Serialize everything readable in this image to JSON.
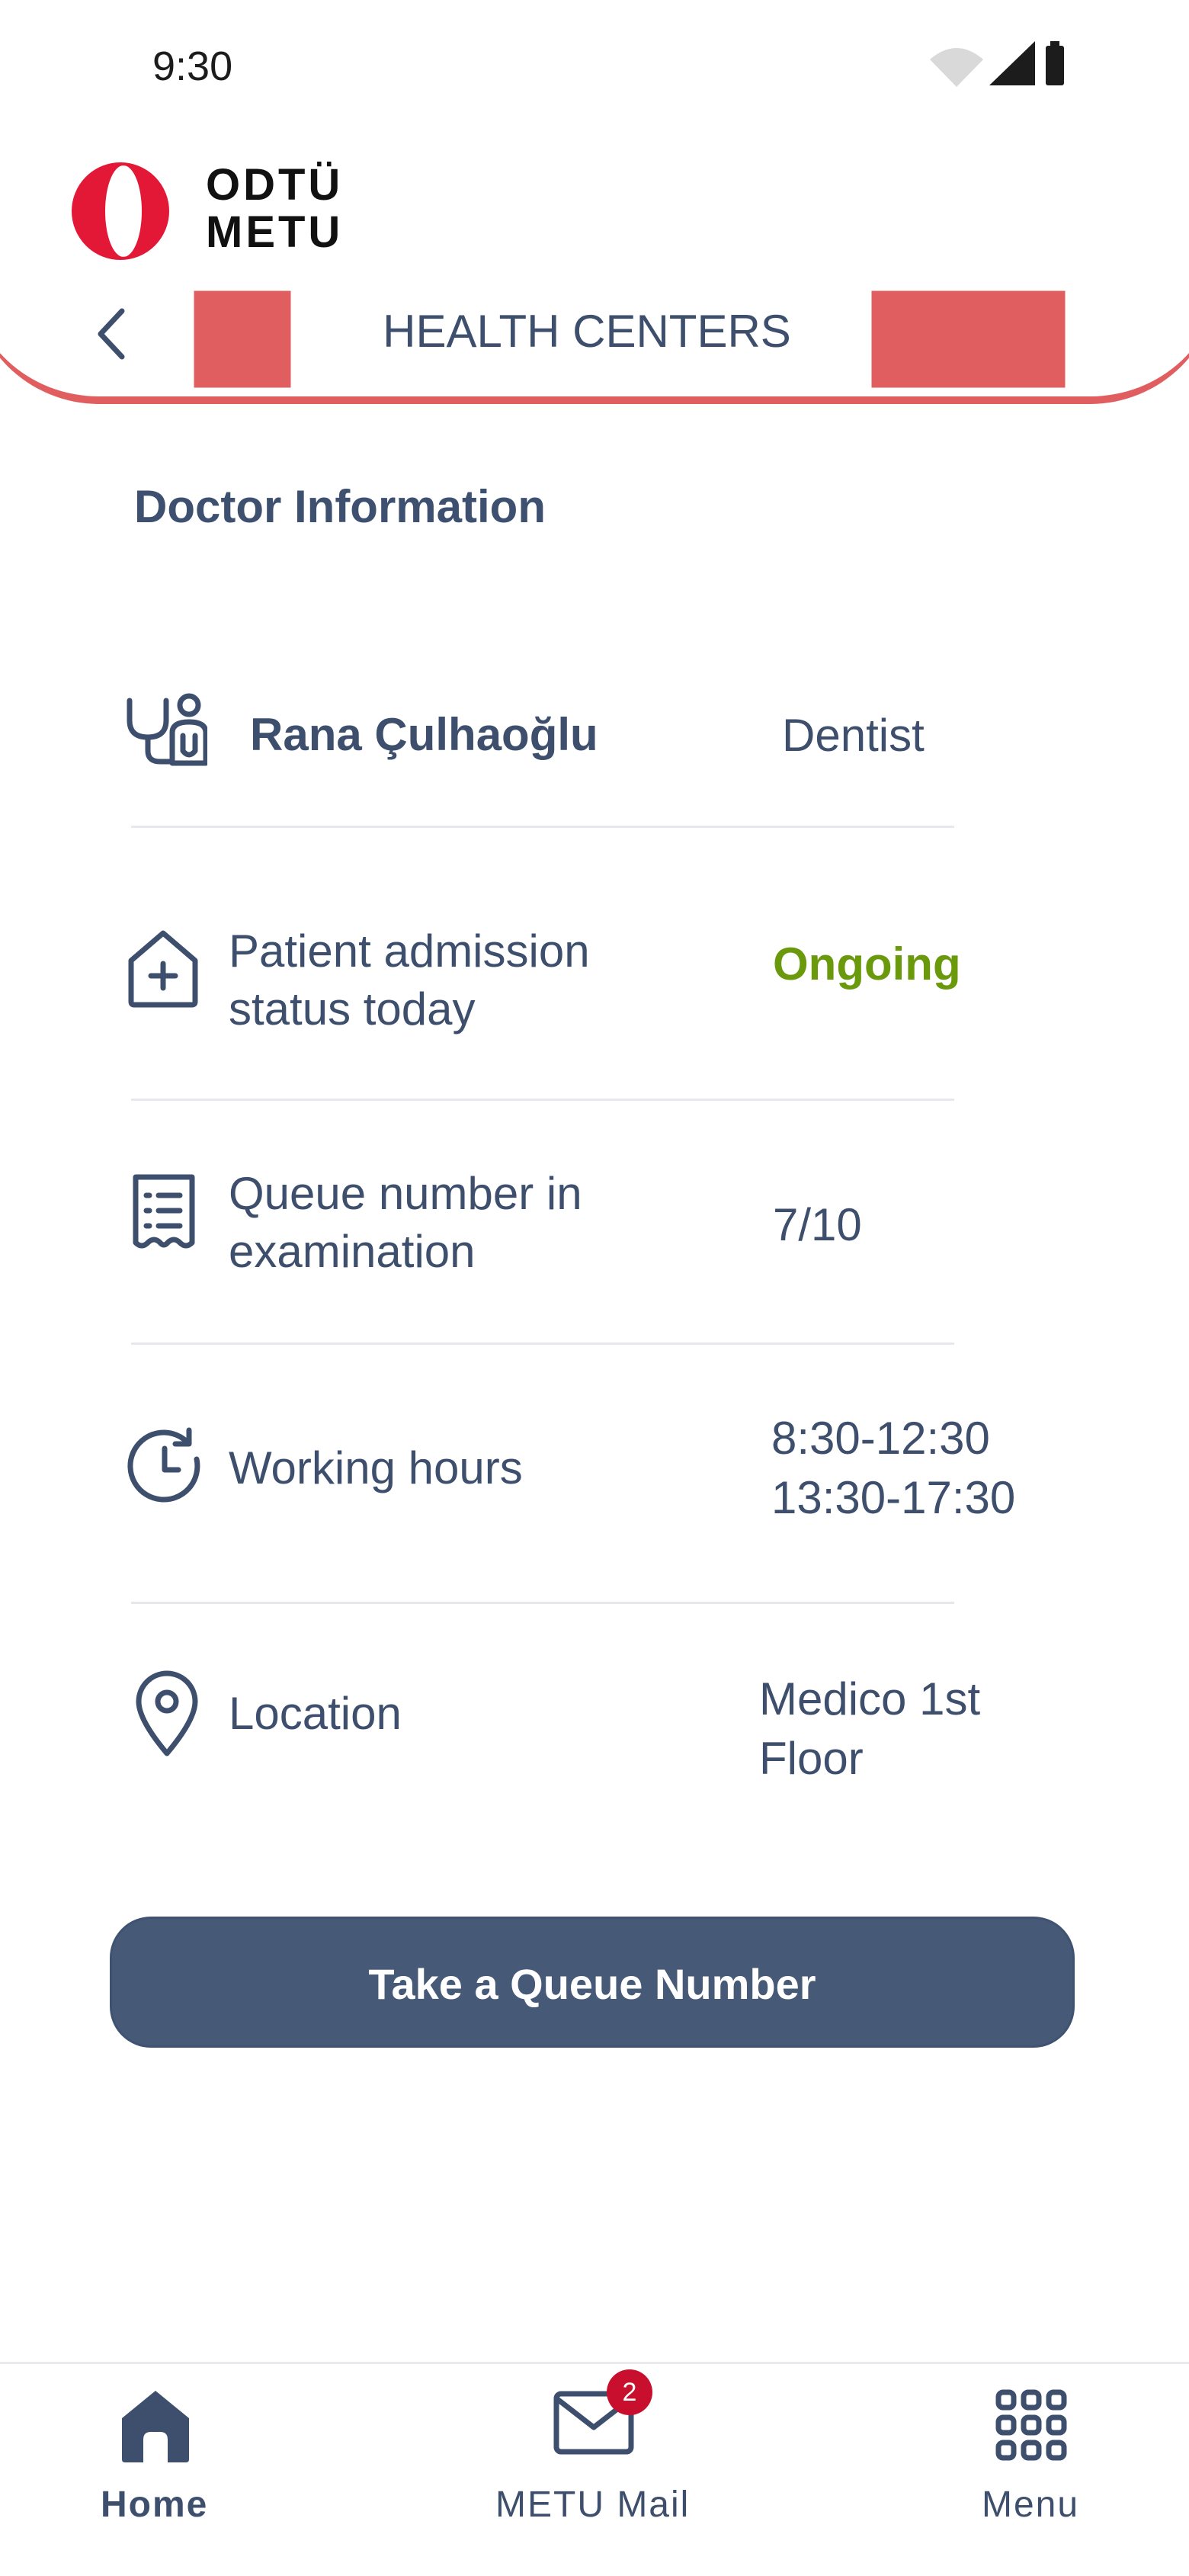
{
  "status_bar": {
    "time": "9:30"
  },
  "brand": {
    "line1": "ODTÜ",
    "line2": "METU"
  },
  "header": {
    "title": "HEALTH CENTERS"
  },
  "section": {
    "title": "Doctor Information"
  },
  "doctor": {
    "name": "Rana Çulhaoğlu",
    "specialty": "Dentist"
  },
  "rows": {
    "admission": {
      "label_line1": "Patient admission",
      "label_line2": "status today",
      "value": "Ongoing",
      "value_color": "#6a9a0c"
    },
    "queue": {
      "label_line1": "Queue number in",
      "label_line2": "examination",
      "value": "7/10"
    },
    "hours": {
      "label": "Working hours",
      "value_line1": "8:30-12:30",
      "value_line2": "13:30-17:30"
    },
    "location": {
      "label": "Location",
      "value_line1": "Medico 1st",
      "value_line2": "Floor"
    }
  },
  "action": {
    "button_label": "Take a Queue Number"
  },
  "bottom_nav": {
    "home": "Home",
    "mail": "METU Mail",
    "mail_badge": "2",
    "menu": "Menu"
  },
  "colors": {
    "accent_red": "#e05e60",
    "primary": "#465977",
    "status_green": "#6a9a0c"
  }
}
